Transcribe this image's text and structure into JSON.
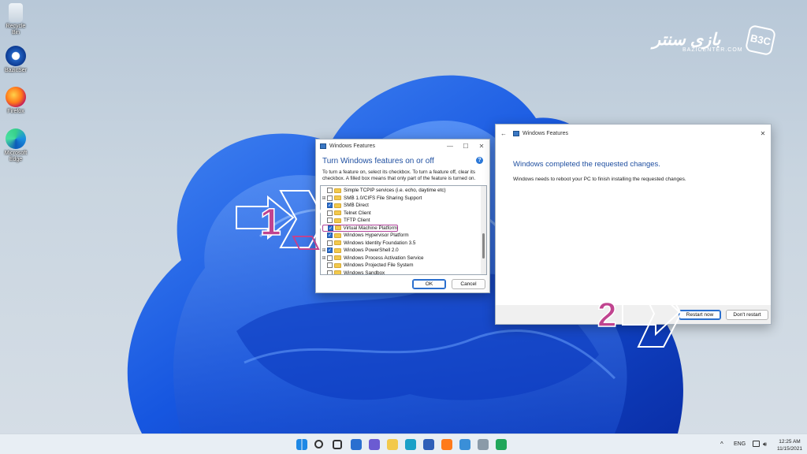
{
  "desktop": {
    "icons": [
      {
        "label": "Recycle Bin"
      },
      {
        "label": "BazicSer"
      },
      {
        "label": "Firefox"
      },
      {
        "label": "Microsoft Edge"
      }
    ]
  },
  "logo": {
    "text_fa": "بازی سنتر",
    "text_en": "BAZICENTER.COM",
    "badge": "B3C"
  },
  "features_window": {
    "title": "Windows Features",
    "controls": {
      "minimize": "—",
      "maximize": "☐",
      "close": "✕"
    },
    "heading": "Turn Windows features on or off",
    "help": "?",
    "description": "To turn a feature on, select its checkbox. To turn a feature off, clear its checkbox. A filled box means that only part of the feature is turned on.",
    "features": [
      {
        "label": "Simple TCPIP services (i.e. echo, daytime etc)",
        "state": "off",
        "expandable": false
      },
      {
        "label": "SMB 1.0/CIFS File Sharing Support",
        "state": "off",
        "expandable": true
      },
      {
        "label": "SMB Direct",
        "state": "on",
        "expandable": false
      },
      {
        "label": "Telnet Client",
        "state": "off",
        "expandable": false
      },
      {
        "label": "TFTP Client",
        "state": "off",
        "expandable": false
      },
      {
        "label": "Virtual Machine Platform",
        "state": "on",
        "expandable": false,
        "highlighted": true
      },
      {
        "label": "Windows Hypervisor Platform",
        "state": "on",
        "expandable": false
      },
      {
        "label": "Windows Identity Foundation 3.5",
        "state": "off",
        "expandable": false
      },
      {
        "label": "Windows PowerShell 2.0",
        "state": "on",
        "expandable": true
      },
      {
        "label": "Windows Process Activation Service",
        "state": "off",
        "expandable": true
      },
      {
        "label": "Windows Projected File System",
        "state": "off",
        "expandable": false
      },
      {
        "label": "Windows Sandbox",
        "state": "off",
        "expandable": false
      }
    ],
    "ok_label": "OK",
    "cancel_label": "Cancel"
  },
  "complete_window": {
    "title": "Windows Features",
    "back": "←",
    "close": "✕",
    "heading": "Windows completed the requested changes.",
    "message": "Windows needs to reboot your PC to finish installing the requested changes.",
    "restart_label": "Restart now",
    "dont_restart_label": "Don't restart"
  },
  "annotations": {
    "step1": "1",
    "step2": "2",
    "color": "#c0448f"
  },
  "taskbar": {
    "apps": [
      "windows-start",
      "search",
      "task-view",
      "widgets",
      "chat",
      "file-explorer",
      "edge",
      "store",
      "firefox",
      "control-panel",
      "features",
      "greenapp"
    ],
    "tray": {
      "chevron": "^",
      "lang": "ENG"
    },
    "clock": {
      "time": "12:25 AM",
      "date": "11/15/2021"
    }
  },
  "colors": {
    "accent": "#2b6fd0",
    "heading": "#1f4fa0",
    "bloom": "#1a5fe0"
  }
}
